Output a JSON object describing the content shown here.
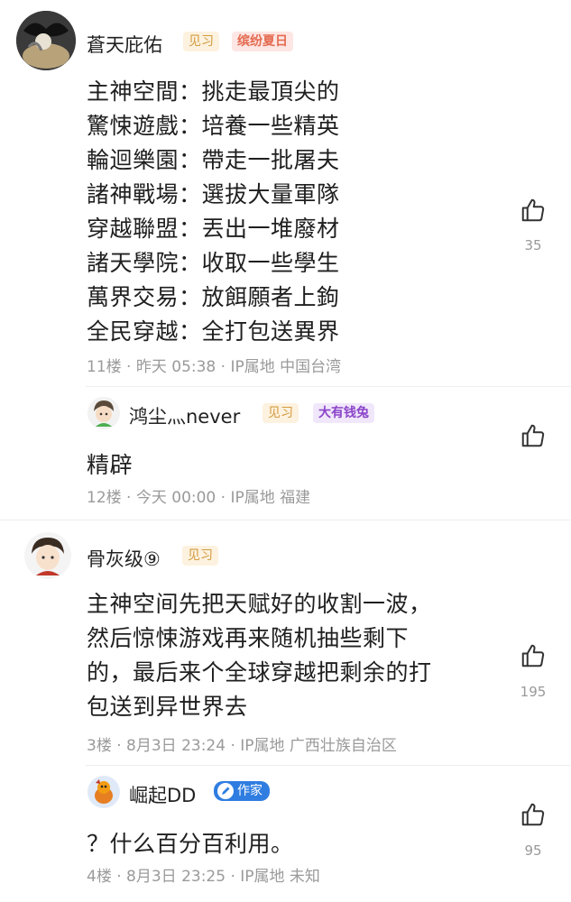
{
  "comments": [
    {
      "username": "蒼天庇佑",
      "level_badge": "见习",
      "event_badge": "缤纷夏日",
      "lines": [
        "主神空間：挑走最頂尖的",
        "驚悚遊戲：培養一些精英",
        "輪迴樂園：帶走一批屠夫",
        "諸神戰場：選拔大量軍隊",
        "穿越聯盟：丟出一堆廢材",
        "諸天學院：收取一些學生",
        "萬界交易：放餌願者上鉤",
        "全民穿越：全打包送異界"
      ],
      "meta": "11楼 · 昨天 05:38 · IP属地 中国台湾",
      "likes": "35"
    },
    {
      "username": "鸿尘灬never",
      "level_badge": "见习",
      "event_badge": "大有钱兔",
      "lines": [
        "精辟"
      ],
      "meta": "12楼 · 今天 00:00 · IP属地 福建",
      "likes": ""
    },
    {
      "username": "骨灰级⑨",
      "level_badge": "见习",
      "lines": [
        "主神空间先把天赋好的收割一波，",
        "然后惊悚游戏再来随机抽些剩下",
        "的，最后来个全球穿越把剩余的打",
        "包送到异世界去"
      ],
      "meta": "3楼 · 8月3日 23:24 · IP属地 广西壮族自治区",
      "likes": "195"
    },
    {
      "username": "崛起DD",
      "author_badge": "作家",
      "lines": [
        "？什么百分百利用。"
      ],
      "meta": "4楼 · 8月3日 23:25 · IP属地 未知",
      "likes": "95"
    }
  ],
  "icons": {
    "like": "thumbs-up-icon",
    "author": "pen-icon"
  },
  "colors": {
    "level_badge": "#d39a3f",
    "event_badge": "#e46a50",
    "rich_badge": "#8a44c9",
    "author_badge": "#2f7de1"
  }
}
